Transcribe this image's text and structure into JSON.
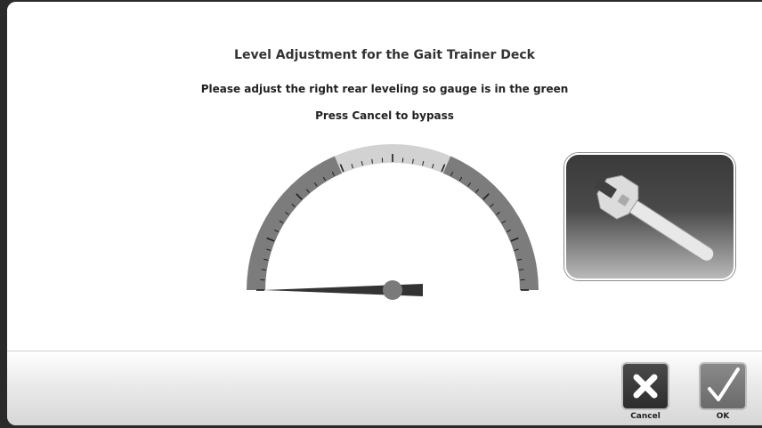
{
  "dialog": {
    "title": "Level Adjustment for the Gait Trainer Deck",
    "instruction": "Please adjust the right rear leveling so gauge is in the green",
    "bypass_hint": "Press Cancel to bypass"
  },
  "gauge": {
    "value_fraction": 0.0,
    "green_zone_fraction": [
      0.37,
      0.63
    ],
    "tick_count": 41,
    "colors": {
      "track": "#7c7c7c",
      "green_zone": "#d2d2d2",
      "needle": "#333333"
    }
  },
  "tool_icon": "wrench-icon",
  "buttons": {
    "cancel_label": "Cancel",
    "ok_label": "OK",
    "cancel_icon": "close-icon",
    "ok_icon": "checkmark-icon"
  }
}
